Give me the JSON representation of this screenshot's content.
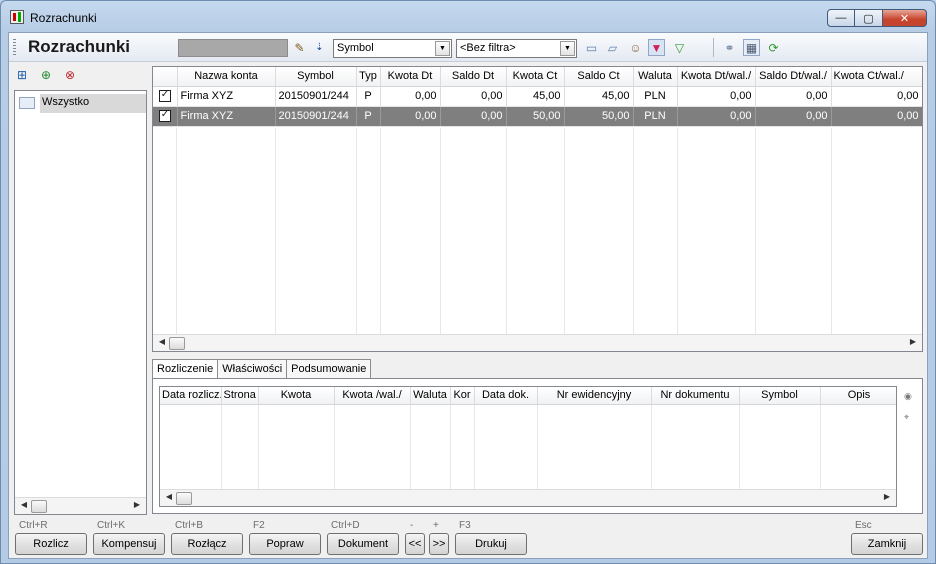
{
  "window": {
    "title": "Rozrachunki",
    "buttons": {
      "minimize": "—",
      "maximize": "▢",
      "close": "✕"
    }
  },
  "toolbar": {
    "title": "Rozrachunki",
    "search_value": "",
    "sort_field": "Symbol",
    "filter": "<Bez filtra>"
  },
  "tree": {
    "items": [
      {
        "label": "Wszystko"
      }
    ]
  },
  "grid": {
    "columns": [
      "",
      "Nazwa konta",
      "Symbol",
      "Typ",
      "Kwota Dt",
      "Saldo Dt",
      "Kwota Ct",
      "Saldo Ct",
      "Waluta",
      "Kwota Dt/wal./",
      "Saldo Dt/wal./",
      "Kwota Ct/wal./"
    ],
    "rows": [
      {
        "checked": true,
        "cells": [
          "Firma XYZ",
          "20150901/244",
          "P",
          "0,00",
          "0,00",
          "45,00",
          "45,00",
          "PLN",
          "0,00",
          "0,00",
          "0,00"
        ],
        "selected": false
      },
      {
        "checked": true,
        "cells": [
          "Firma XYZ",
          "20150901/244",
          "P",
          "0,00",
          "0,00",
          "50,00",
          "50,00",
          "PLN",
          "0,00",
          "0,00",
          "0,00"
        ],
        "selected": true
      }
    ]
  },
  "tabs": [
    {
      "label": "Rozliczenie",
      "active": true
    },
    {
      "label": "Właściwości",
      "active": false
    },
    {
      "label": "Podsumowanie",
      "active": false
    }
  ],
  "detail": {
    "columns": [
      "Data rozlicz.",
      "Strona",
      "Kwota",
      "Kwota /wal./",
      "Waluta",
      "Kor",
      "Data dok.",
      "Nr ewidencyjny",
      "Nr dokumentu",
      "Symbol",
      "Opis"
    ]
  },
  "footer": {
    "buttons": [
      {
        "label": "Rozlicz",
        "shortcut": "Ctrl+R"
      },
      {
        "label": "Kompensuj",
        "shortcut": "Ctrl+K"
      },
      {
        "label": "Rozłącz",
        "shortcut": "Ctrl+B"
      },
      {
        "label": "Popraw",
        "shortcut": "F2"
      },
      {
        "label": "Dokument",
        "shortcut": "Ctrl+D"
      },
      {
        "label": "<<",
        "shortcut": "-"
      },
      {
        "label": ">>",
        "shortcut": "+"
      },
      {
        "label": "Drukuj",
        "shortcut": "F3"
      },
      {
        "label": "Zamknij",
        "shortcut": "Esc"
      }
    ]
  }
}
